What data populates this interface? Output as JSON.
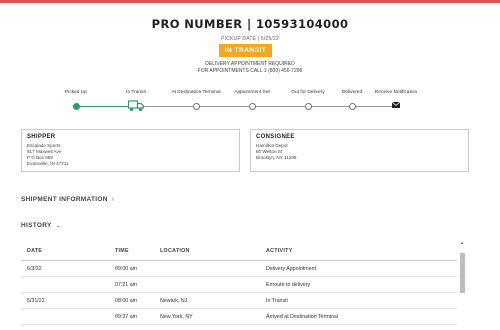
{
  "header": {
    "pro_number": "PRO NUMBER | 10593104000",
    "pickup_date": "PICKUP DATE | 6/25/22",
    "status": "IN TRANSIT",
    "appointment_line1": "DELIVERY APPOINTMENT REQUIRED",
    "appointment_line2": "FOR APPOINTMENTS CALL 1 (800) 456-7296",
    "accent_color": "#f5a623",
    "progress_color": "#2e9c6a"
  },
  "steps": [
    {
      "label": "Picked Up",
      "state": "done",
      "icon": "dot"
    },
    {
      "label": "In Transit",
      "state": "current",
      "icon": "truck-icon"
    },
    {
      "label": "At Destination Terminal",
      "state": "pending",
      "icon": "dot"
    },
    {
      "label": "Appointment Set",
      "state": "pending",
      "icon": "dot"
    },
    {
      "label": "Out for Delivery",
      "state": "pending",
      "icon": "dot"
    },
    {
      "label": "Delivered",
      "state": "pending",
      "icon": "dot"
    },
    {
      "label": "Receive Notification",
      "state": "action",
      "icon": "mail-icon"
    }
  ],
  "shipper": {
    "title": "SHIPPER",
    "lines": [
      "Escalade Sports",
      "817 Maxwell Ave",
      "P O Box 889",
      "Evansville, IN 47711"
    ]
  },
  "consignee": {
    "title": "CONSIGNEE",
    "lines": [
      "Hamilton Depot",
      "80 Welton St",
      "Brooklyn, NY 11208"
    ]
  },
  "sections": {
    "shipment_info": "SHIPMENT INFORMATION",
    "history": "HISTORY"
  },
  "history": {
    "columns": [
      "DATE",
      "TIME",
      "LOCATION",
      "ACTIVITY"
    ],
    "rows": [
      {
        "date": "6/3/22",
        "time": "09:00 am",
        "location": "",
        "activity": "Delivery Appointment"
      },
      {
        "date": "",
        "time": "07:21 am",
        "location": "",
        "activity": "Enroute to delivery"
      },
      {
        "date": "5/31/22",
        "time": "08:00 am",
        "location": "Newark, NJ",
        "activity": "In Transit"
      },
      {
        "date": "",
        "time": "09:37 am",
        "location": "New York, NY",
        "activity": "Arrived at Destination Terminal"
      }
    ]
  }
}
